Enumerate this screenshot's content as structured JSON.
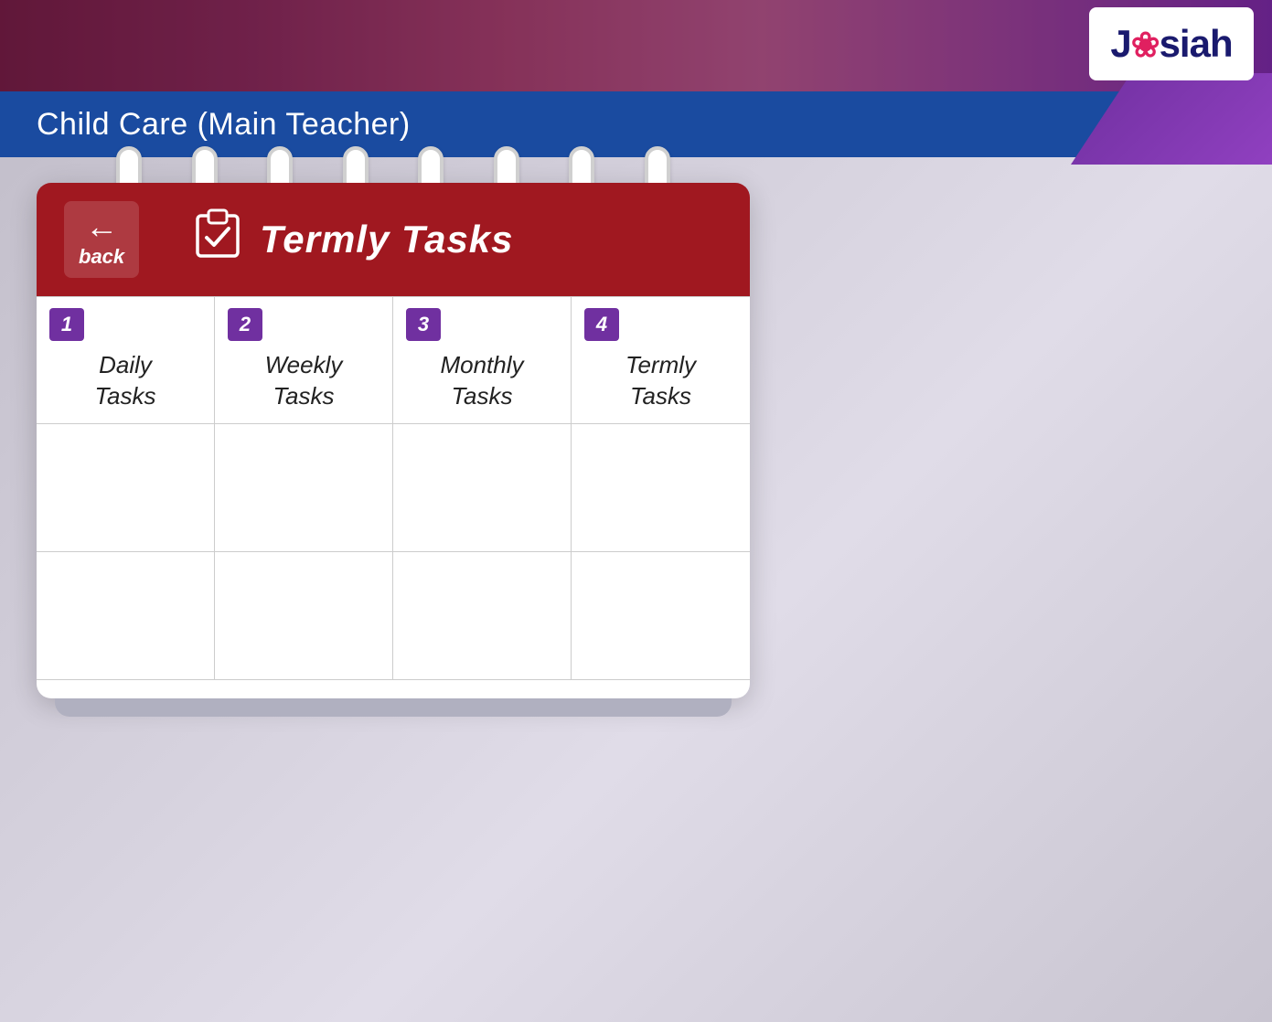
{
  "app": {
    "logo_text": "J",
    "logo_brand": "siah",
    "logo_flower": "❀"
  },
  "title_bar": {
    "title": "Child Care (Main Teacher)"
  },
  "calendar": {
    "back_label": "back",
    "header_title": "Termly Tasks",
    "columns": [
      {
        "number": "1",
        "label": "Daily\nTasks"
      },
      {
        "number": "2",
        "label": "Weekly\nTasks"
      },
      {
        "number": "3",
        "label": "Monthly\nTasks"
      },
      {
        "number": "4",
        "label": "Termly\nTasks"
      }
    ]
  }
}
